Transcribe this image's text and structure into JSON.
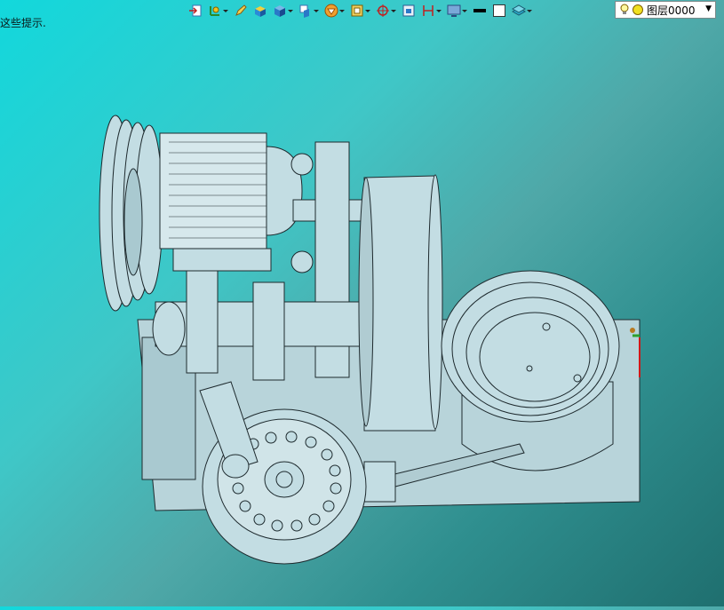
{
  "status": {
    "hint_text": "这些提示."
  },
  "toolbar": {
    "tools": [
      {
        "icon": "import-arrow-icon",
        "has_menu": false
      },
      {
        "icon": "grid-axis-icon",
        "has_menu": true
      },
      {
        "icon": "sketch-pencil-icon",
        "has_menu": false
      },
      {
        "icon": "shaded-box-icon",
        "has_menu": false
      },
      {
        "icon": "cube-view-icon",
        "has_menu": true
      },
      {
        "icon": "view-orient-icon",
        "has_menu": true
      },
      {
        "icon": "render-style-icon",
        "has_menu": true
      },
      {
        "icon": "section-view-icon",
        "has_menu": true
      },
      {
        "icon": "cross-target-icon",
        "has_menu": true
      },
      {
        "icon": "window-frame-icon",
        "has_menu": false
      },
      {
        "icon": "dimension-icon",
        "has_menu": true
      },
      {
        "icon": "screen-display-icon",
        "has_menu": true
      },
      {
        "icon": "line-color-icon",
        "has_menu": false
      },
      {
        "icon": "fill-color-icon",
        "has_menu": false
      },
      {
        "icon": "layer-stack-icon",
        "has_menu": true
      }
    ],
    "layer": {
      "name": "图层0000"
    }
  },
  "colors": {
    "model_fill": "#c3dde3",
    "model_stroke": "#1e2a2e",
    "axis_green": "#2ea02e",
    "axis_red": "#d01818"
  }
}
